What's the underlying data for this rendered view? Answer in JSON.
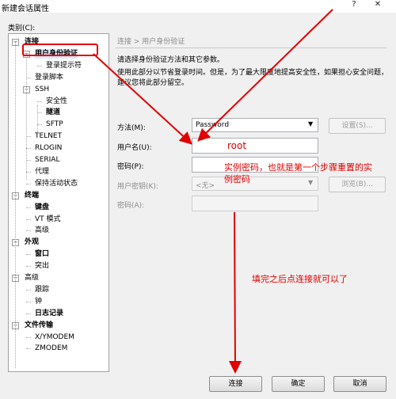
{
  "window": {
    "title": "新建会话属性",
    "help_glyph": "?",
    "close_glyph": "✕"
  },
  "category_label": "类别(C):",
  "tree": {
    "items": [
      {
        "label": "连接",
        "bold": true,
        "toggle": "−"
      },
      {
        "label": "用户身份验证",
        "bold": true,
        "toggle": "−",
        "selected": true
      },
      {
        "label": "登录提示符"
      },
      {
        "label": "登录脚本"
      },
      {
        "label": "SSH",
        "toggle": "−"
      },
      {
        "label": "安全性"
      },
      {
        "label": "隧道",
        "bold": true
      },
      {
        "label": "SFTP"
      },
      {
        "label": "TELNET"
      },
      {
        "label": "RLOGIN"
      },
      {
        "label": "SERIAL"
      },
      {
        "label": "代理"
      },
      {
        "label": "保持活动状态"
      },
      {
        "label": "终端",
        "bold": true,
        "toggle": "−"
      },
      {
        "label": "键盘",
        "bold": true
      },
      {
        "label": "VT 模式"
      },
      {
        "label": "高级"
      },
      {
        "label": "外观",
        "bold": true,
        "toggle": "−"
      },
      {
        "label": "窗口",
        "bold": true
      },
      {
        "label": "突出"
      },
      {
        "label": "高级",
        "toggle": "−"
      },
      {
        "label": "跟踪"
      },
      {
        "label": "钟"
      },
      {
        "label": "日志记录",
        "bold": true
      },
      {
        "label": "文件传输",
        "bold": true,
        "toggle": "−"
      },
      {
        "label": "X/YMODEM"
      },
      {
        "label": "ZMODEM"
      }
    ]
  },
  "breadcrumb": "连接 > 用户身份验证",
  "desc1": "请选择身份验证方法和其它参数。",
  "desc2": "使用此部分以节省登录时间。但是，为了最大限度地提高安全性，如果担心安全问题，",
  "desc3": "建议您将此部分留空。",
  "form": {
    "method_label": "方法(M):",
    "method_value": "Password",
    "settings_button": "设置(S)...",
    "username_label": "用户名(U):",
    "username_value": "root",
    "password_label": "密码(P):",
    "password_value": "",
    "userkey_label": "用户密钥(K):",
    "userkey_value": "<无>",
    "browse_button": "浏览(B)...",
    "passphrase_label": "密码(A):",
    "passphrase_value": ""
  },
  "annotations": {
    "password_note_line1": "实例密码，也就是第一个步骤重置的实",
    "password_note_line2": "例密码",
    "final_note": "填完之后点连接就可以了",
    "color": "#e00000"
  },
  "buttons": {
    "connect": "连接",
    "ok": "确定",
    "cancel": "取消"
  },
  "colors": {
    "selection": "#d9e8fb",
    "annotation": "#e00000",
    "dialog_bg": "#f0f0f0"
  }
}
